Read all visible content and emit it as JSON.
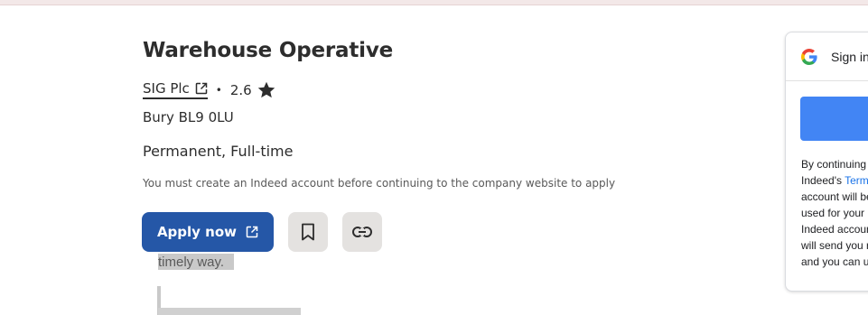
{
  "job": {
    "title": "Warehouse Operative",
    "company": "SIG Plc",
    "separator": "•",
    "rating": "2.6",
    "location": "Bury BL9 0LU",
    "job_type": "Permanent, Full-time",
    "notice": "You must create an Indeed account before continuing to the company website to apply"
  },
  "actions": {
    "apply_label": "Apply now"
  },
  "background": {
    "text_line1": "timely way."
  },
  "google_signin": {
    "title": "Sign in",
    "consent_lines": [
      "By continuing",
      "Indeed's ",
      "account will be",
      "used for your (",
      "Indeed accoun",
      "will send you r",
      "and you can u"
    ],
    "terms_link": "Term"
  },
  "colors": {
    "apply_bg": "#2557a7",
    "icon_btn_bg": "#e4e2e0",
    "google_blue": "#4285f4",
    "link_blue": "#1a73e8"
  }
}
